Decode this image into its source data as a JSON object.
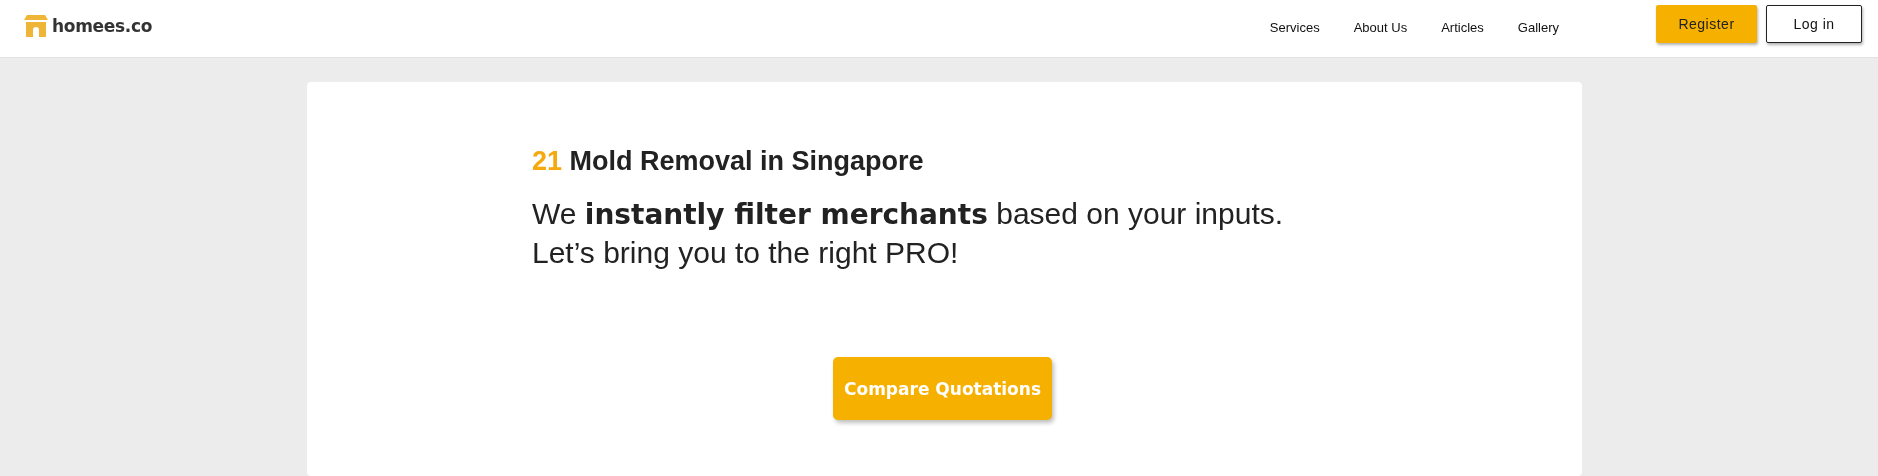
{
  "header": {
    "logo_text": "homees.co",
    "nav": [
      "Services",
      "About Us",
      "Articles",
      "Gallery"
    ],
    "buttons": [
      {
        "label": "Register",
        "kind": "primary"
      },
      {
        "label": "Log in",
        "kind": "outline"
      }
    ]
  },
  "hero": {
    "count": "21",
    "title": "Mold Removal in Singapore",
    "lines": [
      "We **instantly filter merchants** based on your inputs.",
      "Let’s bring you to the right PRO!"
    ],
    "cta": "Compare Quotations"
  }
}
